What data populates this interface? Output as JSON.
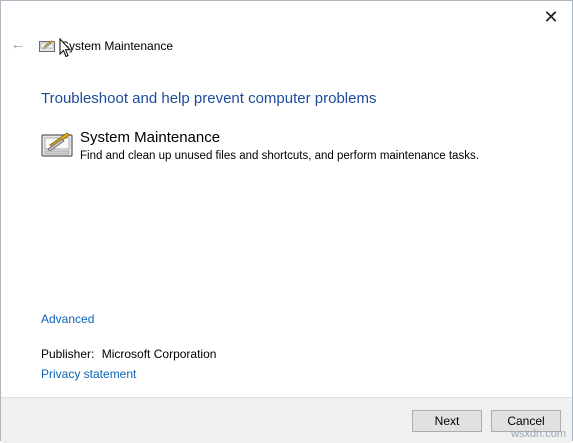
{
  "window": {
    "title": "System Maintenance",
    "close_symbol": "✕"
  },
  "nav": {
    "back_symbol": "←"
  },
  "heading": "Troubleshoot and help prevent computer problems",
  "troubleshooter": {
    "title": "System Maintenance",
    "description": "Find and clean up unused files and shortcuts, and perform maintenance tasks.",
    "icon": "maintenance-tools-icon"
  },
  "advanced_link": "Advanced",
  "publisher": {
    "label": "Publisher:",
    "value": "Microsoft Corporation"
  },
  "privacy_link": "Privacy statement",
  "buttons": {
    "next": "Next",
    "cancel": "Cancel"
  },
  "watermark": "wsxdn.com",
  "colors": {
    "heading": "#1c4b9c",
    "link": "#0b63b6",
    "footer_bg": "#f0f0f0"
  }
}
